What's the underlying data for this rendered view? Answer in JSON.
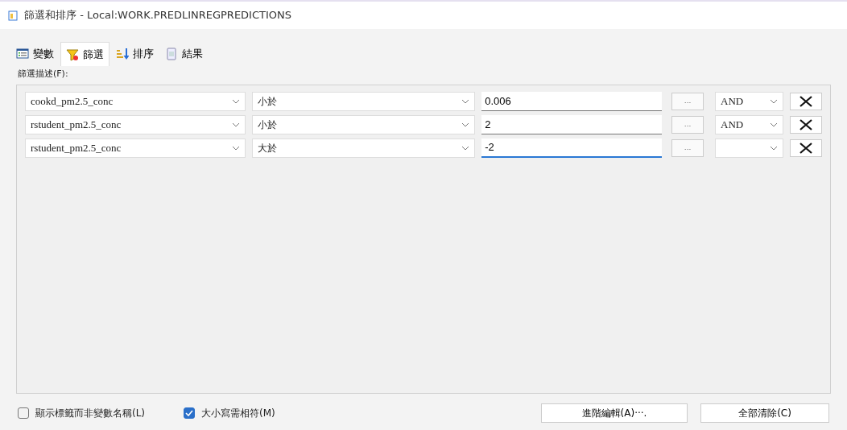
{
  "window": {
    "title": "篩選和排序 - Local:WORK.PREDLINREGPREDICTIONS"
  },
  "tabs": [
    {
      "label": "變數",
      "kind": "variables",
      "selected": false
    },
    {
      "label": "篩選",
      "kind": "filter",
      "selected": true
    },
    {
      "label": "排序",
      "kind": "sort",
      "selected": false
    },
    {
      "label": "結果",
      "kind": "results",
      "selected": false
    }
  ],
  "filter_label": "篩選描述(F):",
  "conditions": [
    {
      "variable": "cookd_pm2.5_conc",
      "operator": "小於",
      "value": "0.006",
      "focused": false,
      "ellipsis": "...",
      "connector": "AND"
    },
    {
      "variable": "rstudent_pm2.5_conc",
      "operator": "小於",
      "value": "2",
      "focused": false,
      "ellipsis": "...",
      "connector": "AND"
    },
    {
      "variable": "rstudent_pm2.5_conc",
      "operator": "大於",
      "value": "-2",
      "focused": true,
      "ellipsis": "..."
    }
  ],
  "options": [
    {
      "label": "顯示標籤而非變數名稱(L)",
      "checked": false
    },
    {
      "label": "大小寫需相符(M)",
      "checked": true
    }
  ],
  "buttons": [
    "進階編輯(A)···.",
    "全部清除(C)"
  ]
}
